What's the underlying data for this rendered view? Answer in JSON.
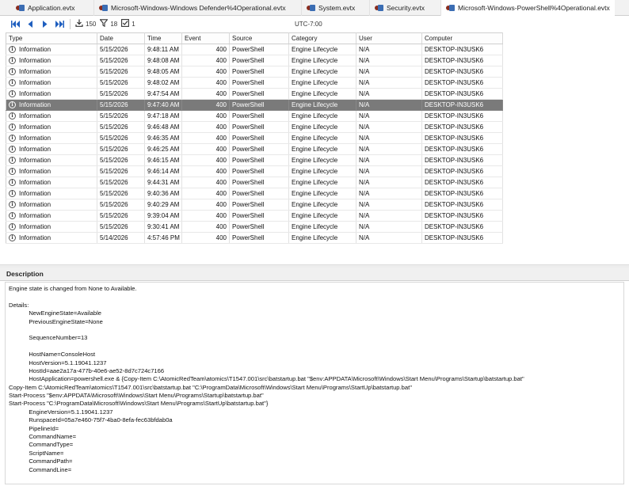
{
  "tabs": [
    {
      "label": "Application.evtx",
      "active": false
    },
    {
      "label": "Microsoft-Windows-Windows Defender%4Operational.evtx",
      "active": false
    },
    {
      "label": "System.evtx",
      "active": false
    },
    {
      "label": "Security.evtx",
      "active": false
    },
    {
      "label": "Microsoft-Windows-PowerShell%4Operational.evtx",
      "active": true
    }
  ],
  "toolbar": {
    "first_icon": "first-page-icon",
    "prev_icon": "previous-icon",
    "next_icon": "next-icon",
    "last_icon": "last-page-icon",
    "loaded_count": "150",
    "filtered_count": "18",
    "selected_count": "1",
    "timezone": "UTC-7:00"
  },
  "grid": {
    "columns": [
      "Type",
      "Date",
      "Time",
      "Event",
      "Source",
      "Category",
      "User",
      "Computer"
    ],
    "rows": [
      [
        "Information",
        "5/15/2026",
        "9:48:11 AM",
        "400",
        "PowerShell",
        "Engine Lifecycle",
        "N/A",
        "DESKTOP-IN3USK6"
      ],
      [
        "Information",
        "5/15/2026",
        "9:48:08 AM",
        "400",
        "PowerShell",
        "Engine Lifecycle",
        "N/A",
        "DESKTOP-IN3USK6"
      ],
      [
        "Information",
        "5/15/2026",
        "9:48:05 AM",
        "400",
        "PowerShell",
        "Engine Lifecycle",
        "N/A",
        "DESKTOP-IN3USK6"
      ],
      [
        "Information",
        "5/15/2026",
        "9:48:02 AM",
        "400",
        "PowerShell",
        "Engine Lifecycle",
        "N/A",
        "DESKTOP-IN3USK6"
      ],
      [
        "Information",
        "5/15/2026",
        "9:47:54 AM",
        "400",
        "PowerShell",
        "Engine Lifecycle",
        "N/A",
        "DESKTOP-IN3USK6"
      ],
      [
        "Information",
        "5/15/2026",
        "9:47:40 AM",
        "400",
        "PowerShell",
        "Engine Lifecycle",
        "N/A",
        "DESKTOP-IN3USK6"
      ],
      [
        "Information",
        "5/15/2026",
        "9:47:18 AM",
        "400",
        "PowerShell",
        "Engine Lifecycle",
        "N/A",
        "DESKTOP-IN3USK6"
      ],
      [
        "Information",
        "5/15/2026",
        "9:46:48 AM",
        "400",
        "PowerShell",
        "Engine Lifecycle",
        "N/A",
        "DESKTOP-IN3USK6"
      ],
      [
        "Information",
        "5/15/2026",
        "9:46:35 AM",
        "400",
        "PowerShell",
        "Engine Lifecycle",
        "N/A",
        "DESKTOP-IN3USK6"
      ],
      [
        "Information",
        "5/15/2026",
        "9:46:25 AM",
        "400",
        "PowerShell",
        "Engine Lifecycle",
        "N/A",
        "DESKTOP-IN3USK6"
      ],
      [
        "Information",
        "5/15/2026",
        "9:46:15 AM",
        "400",
        "PowerShell",
        "Engine Lifecycle",
        "N/A",
        "DESKTOP-IN3USK6"
      ],
      [
        "Information",
        "5/15/2026",
        "9:46:14 AM",
        "400",
        "PowerShell",
        "Engine Lifecycle",
        "N/A",
        "DESKTOP-IN3USK6"
      ],
      [
        "Information",
        "5/15/2026",
        "9:44:31 AM",
        "400",
        "PowerShell",
        "Engine Lifecycle",
        "N/A",
        "DESKTOP-IN3USK6"
      ],
      [
        "Information",
        "5/15/2026",
        "9:40:36 AM",
        "400",
        "PowerShell",
        "Engine Lifecycle",
        "N/A",
        "DESKTOP-IN3USK6"
      ],
      [
        "Information",
        "5/15/2026",
        "9:40:29 AM",
        "400",
        "PowerShell",
        "Engine Lifecycle",
        "N/A",
        "DESKTOP-IN3USK6"
      ],
      [
        "Information",
        "5/15/2026",
        "9:39:04 AM",
        "400",
        "PowerShell",
        "Engine Lifecycle",
        "N/A",
        "DESKTOP-IN3USK6"
      ],
      [
        "Information",
        "5/15/2026",
        "9:30:41 AM",
        "400",
        "PowerShell",
        "Engine Lifecycle",
        "N/A",
        "DESKTOP-IN3USK6"
      ],
      [
        "Information",
        "5/14/2026",
        "4:57:46 PM",
        "400",
        "PowerShell",
        "Engine Lifecycle",
        "N/A",
        "DESKTOP-IN3USK6"
      ]
    ],
    "selected_row_index": 5,
    "row_icon": "information-icon"
  },
  "description": {
    "header": "Description",
    "lines": [
      "Engine state is changed from None to Available.",
      "",
      "Details:",
      "            NewEngineState=Available",
      "            PreviousEngineState=None",
      "",
      "            SequenceNumber=13",
      "",
      "            HostName=ConsoleHost",
      "            HostVersion=5.1.19041.1237",
      "            HostId=aae2a17a-477b-40e6-ae52-8d7c724c7166",
      "            HostApplication=powershell.exe & {Copy-Item C:\\AtomicRedTeam\\atomics\\T1547.001\\src\\batstartup.bat \"$env:APPDATA\\Microsoft\\Windows\\Start Menu\\Programs\\Startup\\batstartup.bat\"",
      "Copy-Item C:\\AtomicRedTeam\\atomics\\T1547.001\\src\\batstartup.bat \"C:\\ProgramData\\Microsoft\\Windows\\Start Menu\\Programs\\StartUp\\batstartup.bat\"",
      "Start-Process \"$env:APPDATA\\Microsoft\\Windows\\Start Menu\\Programs\\Startup\\batstartup.bat\"",
      "Start-Process \"C:\\ProgramData\\Microsoft\\Windows\\Start Menu\\Programs\\StartUp\\batstartup.bat\"}",
      "            EngineVersion=5.1.19041.1237",
      "            RunspaceId=05a7e460-75f7-4ba0-8efa-fec63bfdab0a",
      "            PipelineId=",
      "            CommandName=",
      "            CommandType=",
      "            ScriptName=",
      "            CommandPath=",
      "            CommandLine="
    ]
  }
}
